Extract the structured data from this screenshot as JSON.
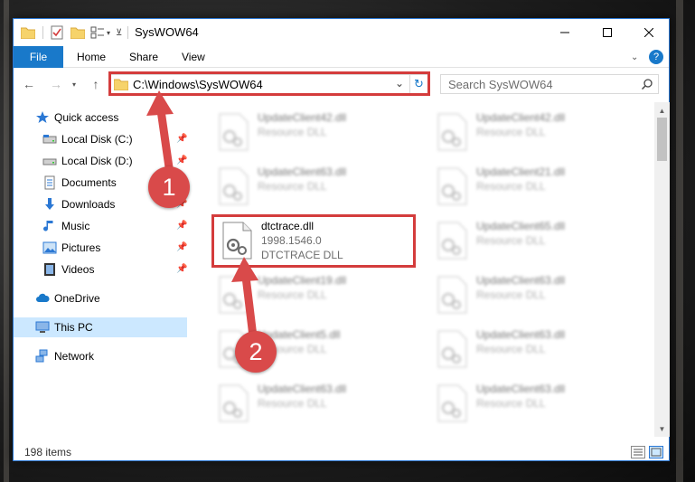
{
  "window": {
    "title": "SysWOW64"
  },
  "ribbon": {
    "tabs": [
      {
        "label": "File"
      },
      {
        "label": "Home"
      },
      {
        "label": "Share"
      },
      {
        "label": "View"
      }
    ]
  },
  "address_bar": {
    "path": "C:\\Windows\\SysWOW64"
  },
  "search": {
    "placeholder": "Search SysWOW64"
  },
  "nav_pane": {
    "items": [
      {
        "label": "Quick access",
        "icon": "star-icon"
      },
      {
        "label": "Local Disk (C:)",
        "icon": "drive-icon",
        "pinned": true
      },
      {
        "label": "Local Disk (D:)",
        "icon": "drive-icon",
        "pinned": true
      },
      {
        "label": "Documents",
        "icon": "documents-icon",
        "pinned": true
      },
      {
        "label": "Downloads",
        "icon": "download-icon",
        "pinned": true
      },
      {
        "label": "Music",
        "icon": "music-icon",
        "pinned": true
      },
      {
        "label": "Pictures",
        "icon": "pictures-icon",
        "pinned": true
      },
      {
        "label": "Videos",
        "icon": "videos-icon",
        "pinned": true
      },
      {
        "label": "OneDrive",
        "icon": "cloud-icon"
      },
      {
        "label": "This PC",
        "icon": "computer-icon",
        "selected": true
      },
      {
        "label": "Network",
        "icon": "network-icon"
      }
    ]
  },
  "files": [
    {
      "name": "UpdateClient42.dll",
      "type": "Resource DLL",
      "blurred": true
    },
    {
      "name": "UpdateClient42.dll",
      "type": "Resource DLL",
      "blurred": true
    },
    {
      "name": "UpdateClient63.dll",
      "type": "Resource DLL",
      "blurred": true
    },
    {
      "name": "UpdateClient21.dll",
      "type": "Resource DLL",
      "blurred": true
    },
    {
      "name": "dtctrace.dll",
      "version": "1998.1546.0",
      "type": "DTCTRACE DLL",
      "blurred": false
    },
    {
      "name": "UpdateClient65.dll",
      "type": "Resource DLL",
      "blurred": true
    },
    {
      "name": "UpdateClient19.dll",
      "type": "Resource DLL",
      "blurred": true
    },
    {
      "name": "UpdateClient63.dll",
      "type": "Resource DLL",
      "blurred": true
    },
    {
      "name": "UpdateClient5.dll",
      "type": "Resource DLL",
      "blurred": true
    },
    {
      "name": "UpdateClient63.dll",
      "type": "Resource DLL",
      "blurred": true
    },
    {
      "name": "UpdateClient63.dll",
      "type": "Resource DLL",
      "blurred": true
    },
    {
      "name": "UpdateClient63.dll",
      "type": "Resource DLL",
      "blurred": true
    }
  ],
  "status": {
    "item_count": "198 items"
  },
  "callouts": [
    {
      "label": "1"
    },
    {
      "label": "2"
    }
  ],
  "colors": {
    "accent": "#1979ca",
    "highlight_red": "#d43c3c",
    "callout_red": "#d94a4a",
    "selection": "#cce8ff"
  }
}
